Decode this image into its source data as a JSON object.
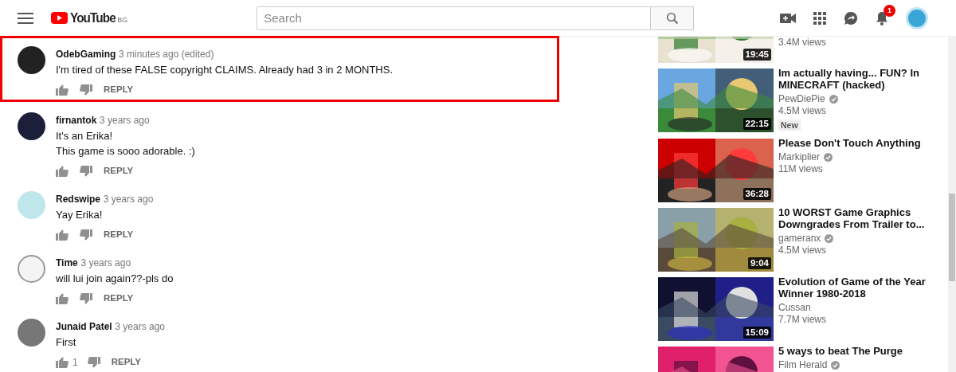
{
  "header": {
    "logo": "YouTube",
    "country": "BG",
    "search": {
      "placeholder": "Search"
    },
    "notifications": "1"
  },
  "comments": [
    {
      "author": "OdebGaming",
      "time": "3 minutes ago (edited)",
      "text": "I'm tired of these FALSE copyright CLAIMS. Already had 3 in 2 MONTHS.",
      "reply": "REPLY",
      "highlighted": true
    },
    {
      "author": "firnantok",
      "time": "3 years ago",
      "text": "It's an Erika!\nThis game is sooo adorable. :)",
      "reply": "REPLY",
      "highlighted": false
    },
    {
      "author": "Redswipe",
      "time": "3 years ago",
      "text": "Yay Erika!",
      "reply": "REPLY",
      "highlighted": false
    },
    {
      "author": "Time",
      "time": "3 years ago",
      "text": "will lui join again??-pls do",
      "reply": "REPLY",
      "highlighted": false
    },
    {
      "author": "Junaid Patel",
      "time": "3 years ago",
      "text": "First",
      "likes": "1",
      "reply": "REPLY",
      "highlighted": false
    }
  ],
  "videos": [
    {
      "kind": "partial",
      "views": "3.4M views",
      "duration": "19:45"
    },
    {
      "kind": "full",
      "title": "Im actually having... FUN? In MINECRAFT (hacked)",
      "channel": "PewDiePie",
      "verified": true,
      "views": "4.5M views",
      "badge": "New",
      "duration": "22:15"
    },
    {
      "kind": "full",
      "title": "Please Don't Touch Anything",
      "channel": "Markiplier",
      "verified": true,
      "views": "11M views",
      "duration": "36:28"
    },
    {
      "kind": "full",
      "title": "10 WORST Game Graphics Downgrades From Trailer to...",
      "channel": "gameranx",
      "verified": true,
      "views": "4.5M views",
      "duration": "9:04"
    },
    {
      "kind": "full",
      "title": "Evolution of Game of the Year Winner 1980-2018",
      "channel": "Cussan",
      "verified": false,
      "views": "7.7M views",
      "duration": "15:09"
    },
    {
      "kind": "cut",
      "title": "5 ways to beat The Purge",
      "channel": "Film Herald",
      "verified": true
    }
  ]
}
